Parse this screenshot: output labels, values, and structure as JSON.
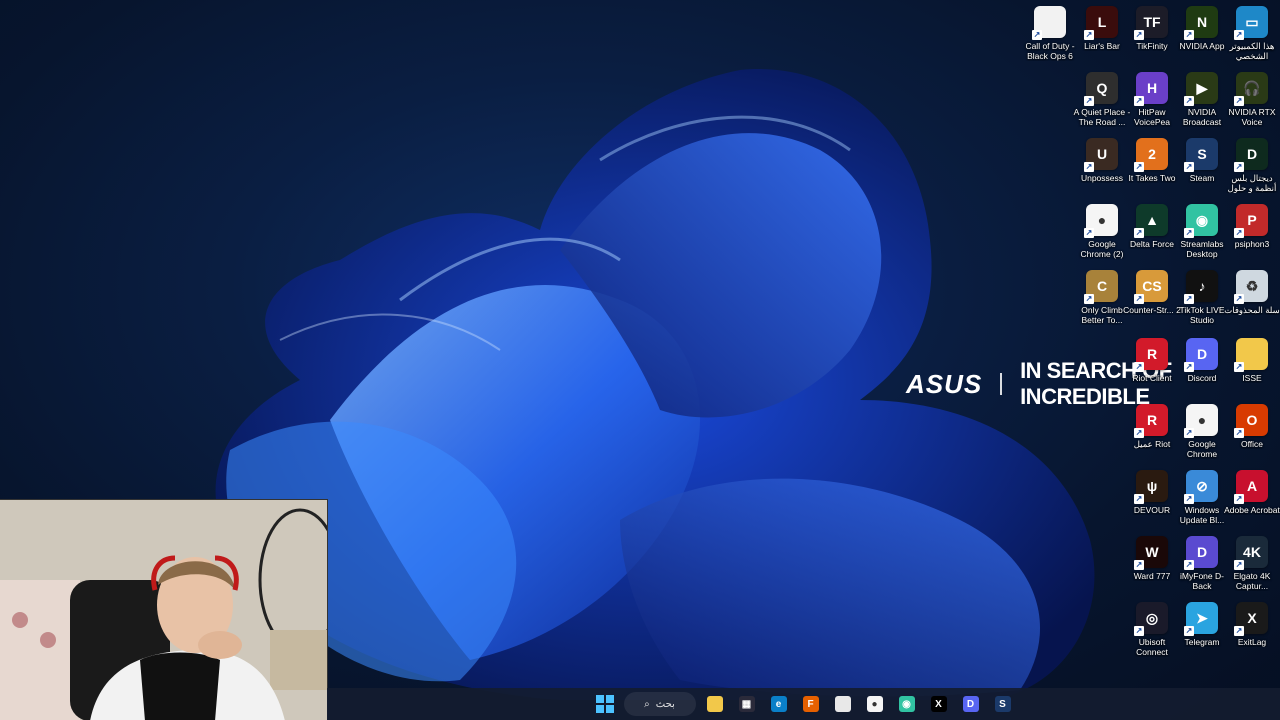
{
  "wallpaper": {
    "brand_logo": "ASUS",
    "brand_tagline": "IN SEARCH OF INCREDIBLE"
  },
  "desktop_icons": [
    {
      "label": "Call of Duty - Black Ops 6",
      "icon": "document-file-icon",
      "color": "#f2f2f2",
      "glyph": ""
    },
    {
      "label": "Liar's Bar",
      "icon": "liars-bar-icon",
      "color": "#3a0c0c",
      "glyph": "L"
    },
    {
      "label": "TikFinity",
      "icon": "tikfinity-icon",
      "color": "#1c1c28",
      "glyph": "TF"
    },
    {
      "label": "NVIDIA App",
      "icon": "nvidia-icon",
      "color": "#1f3b12",
      "glyph": "N"
    },
    {
      "label": "هذا الكمبيوتر الشخصي",
      "icon": "this-pc-icon",
      "color": "#1e88c8",
      "glyph": "▭"
    },
    {
      "label": "A Quiet Place - The Road ...",
      "icon": "a-quiet-place-icon",
      "color": "#2e2e2e",
      "glyph": "Q"
    },
    {
      "label": "HitPaw VoicePea",
      "icon": "hitpaw-icon",
      "color": "#6a3fc8",
      "glyph": "H"
    },
    {
      "label": "NVIDIA Broadcast",
      "icon": "nvidia-broadcast-icon",
      "color": "#2a3a16",
      "glyph": "▶"
    },
    {
      "label": "NVIDIA RTX Voice",
      "icon": "nvidia-rtx-voice-icon",
      "color": "#2a3a16",
      "glyph": "🎧"
    },
    {
      "label": "Unpossess",
      "icon": "unpossess-icon",
      "color": "#3a2a22",
      "glyph": "U"
    },
    {
      "label": "It Takes Two",
      "icon": "it-takes-two-icon",
      "color": "#e2701c",
      "glyph": "2"
    },
    {
      "label": "Steam",
      "icon": "steam-icon",
      "color": "#1b3a6a",
      "glyph": "S"
    },
    {
      "label": "ديجتال بلس أنظمة و حلول",
      "icon": "digital-plus-icon",
      "color": "#0e2a1e",
      "glyph": "D"
    },
    {
      "label": "Google Chrome (2)",
      "icon": "chrome-icon",
      "color": "#f5f5f5",
      "glyph": "●"
    },
    {
      "label": "Delta Force",
      "icon": "delta-force-icon",
      "color": "#0e3a2a",
      "glyph": "▲"
    },
    {
      "label": "Streamlabs Desktop",
      "icon": "streamlabs-icon",
      "color": "#31c3a2",
      "glyph": "◉"
    },
    {
      "label": "psiphon3",
      "icon": "psiphon-icon",
      "color": "#c22a2a",
      "glyph": "P"
    },
    {
      "label": "Only Climb Better To...",
      "icon": "only-climb-icon",
      "color": "#a8823a",
      "glyph": "C"
    },
    {
      "label": "Counter-Str... 2",
      "icon": "counter-strike-icon",
      "color": "#d89a3a",
      "glyph": "CS"
    },
    {
      "label": "TikTok LIVE Studio",
      "icon": "tiktok-icon",
      "color": "#111111",
      "glyph": "♪"
    },
    {
      "label": "سلة المحذوفات",
      "icon": "recycle-bin-icon",
      "color": "#cfd8e0",
      "glyph": "♻"
    },
    {
      "label": "Riot Client",
      "icon": "riot-client-icon",
      "color": "#d21a2a",
      "glyph": "R"
    },
    {
      "label": "Discord",
      "icon": "discord-icon",
      "color": "#5865f2",
      "glyph": "D"
    },
    {
      "label": "ISSE",
      "icon": "folder-icon",
      "color": "#f2c84a",
      "glyph": ""
    },
    {
      "label": "عميل Riot",
      "icon": "riot-client-ar-icon",
      "color": "#d21a2a",
      "glyph": "R"
    },
    {
      "label": "Google Chrome",
      "icon": "chrome-icon",
      "color": "#f5f5f5",
      "glyph": "●"
    },
    {
      "label": "Office",
      "icon": "office-icon",
      "color": "#d83b01",
      "glyph": "O"
    },
    {
      "label": "DEVOUR",
      "icon": "devour-icon",
      "color": "#2a1a10",
      "glyph": "ψ"
    },
    {
      "label": "Windows Update Bl...",
      "icon": "windows-update-blocker-icon",
      "color": "#3a8ad8",
      "glyph": "⊘"
    },
    {
      "label": "Adobe Acrobat",
      "icon": "adobe-acrobat-icon",
      "color": "#c8102e",
      "glyph": "A"
    },
    {
      "label": "Ward 777",
      "icon": "ward-777-icon",
      "color": "#1a0808",
      "glyph": "W"
    },
    {
      "label": "iMyFone D-Back",
      "icon": "imyfone-icon",
      "color": "#5a4ad0",
      "glyph": "D"
    },
    {
      "label": "Elgato 4K Captur...",
      "icon": "elgato-icon",
      "color": "#1a2a3a",
      "glyph": "4K"
    },
    {
      "label": "Ubisoft Connect",
      "icon": "ubisoft-icon",
      "color": "#1a1a2a",
      "glyph": "◎"
    },
    {
      "label": "Telegram",
      "icon": "telegram-icon",
      "color": "#2aa4e0",
      "glyph": "➤"
    },
    {
      "label": "ExitLag",
      "icon": "exitlag-icon",
      "color": "#1a1a1a",
      "glyph": "X"
    }
  ],
  "taskbar": {
    "search_label": "بحث",
    "apps": [
      {
        "name": "steam-taskbar-icon",
        "color": "#1b3a6a",
        "glyph": "S"
      },
      {
        "name": "discord-taskbar-icon",
        "color": "#5865f2",
        "glyph": "D"
      },
      {
        "name": "capcut-taskbar-icon",
        "color": "#000000",
        "glyph": "X"
      },
      {
        "name": "streamlabs-taskbar-icon",
        "color": "#31c3a2",
        "glyph": "◉"
      },
      {
        "name": "chrome-taskbar-icon",
        "color": "#f5f5f5",
        "glyph": "●"
      },
      {
        "name": "file-taskbar-icon",
        "color": "#e8e8e8",
        "glyph": ""
      },
      {
        "name": "firefox-taskbar-icon",
        "color": "#e66000",
        "glyph": "F"
      },
      {
        "name": "edge-taskbar-icon",
        "color": "#0a7fc8",
        "glyph": "e"
      },
      {
        "name": "store-taskbar-icon",
        "color": "#2a2a3a",
        "glyph": "▦"
      },
      {
        "name": "file-explorer-taskbar-icon",
        "color": "#f2c84a",
        "glyph": ""
      }
    ]
  }
}
